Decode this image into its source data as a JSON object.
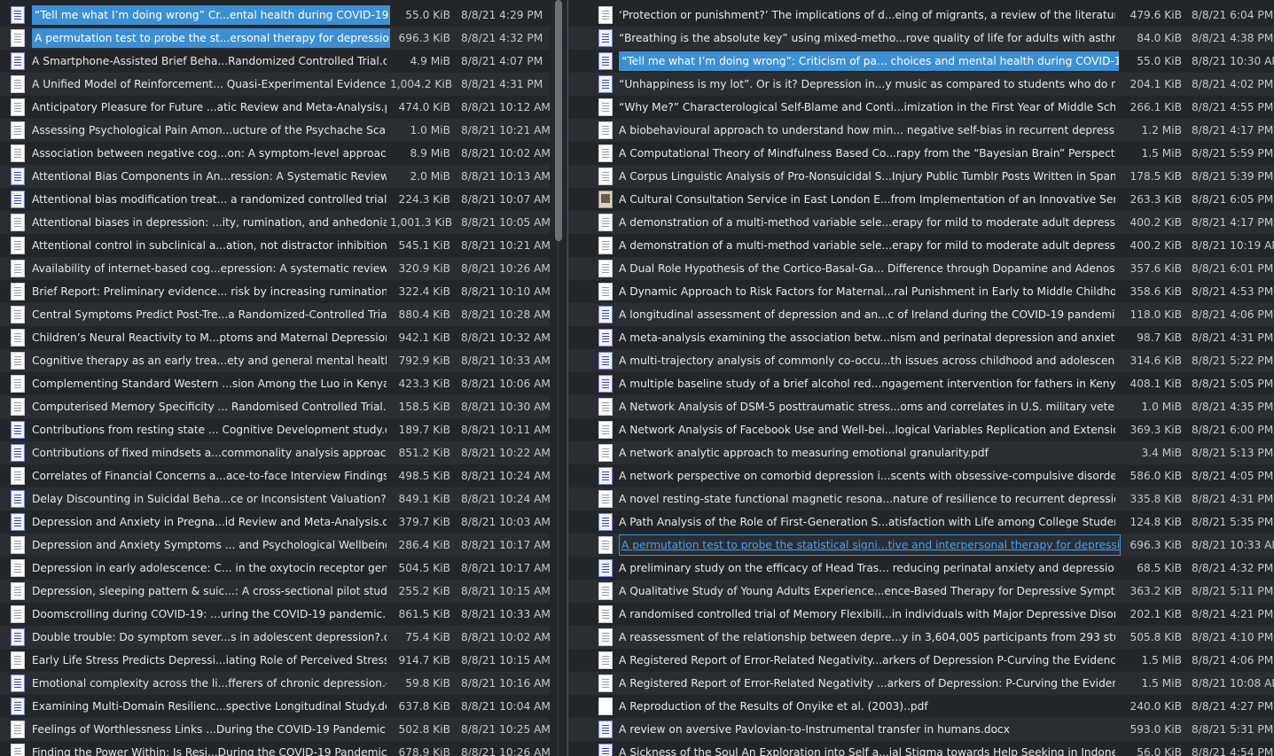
{
  "left": {
    "rows": [
      {
        "icon": "docx",
        "name": "“Tell me what I’m doing wrong” Cr...ental health during COVID-19.docx",
        "size": "55.0 KiB",
        "date": "8/8/21 4:29 PM",
        "state": "selected"
      },
      {
        "icon": "pdf",
        "name": "A permutation test to probe the st...ersonal therapy for depression.pdf",
        "size": "696.3 KiB",
        "date": "8/8/21 4:32 PM",
        "state": "selected"
      },
      {
        "icon": "docx",
        "name": "A Smartphone-Assisted Brief Beha...Randomized Controlled Trial.docx",
        "size": "4.9 MiB",
        "date": "8/8/21 4:07 PM"
      },
      {
        "icon": "pdf",
        "name": "A Unified Model of Reinforcement... Quasi-Experimental Evidence.pdf",
        "size": "1,004.2 KiB",
        "date": "8/8/21 4:31 PM"
      },
      {
        "icon": "pdf",
        "name": "Anticipatory Pleasure for Future ...atic Review and Meta-Analysis.pdf",
        "size": "474.0 KiB",
        "date": "8/8/21 10:12 AM"
      },
      {
        "icon": "pdf",
        "name": "Assessing Psychological Pain Amon...ucture of the Psychache Scale.pdf",
        "size": "1.0 MiB",
        "date": "8/8/21 10:21 AM"
      },
      {
        "icon": "pdf",
        "name": "Association between negative cog...on: A symptom-level approach.pdf",
        "size": "8.9 MiB",
        "date": "8/8/21 10:02 AM"
      },
      {
        "icon": "docx",
        "name": "Attentional Bias Components in An...ression: A Systematic Review.docx",
        "size": "2.0 MiB",
        "date": "8/8/21 10:13 AM"
      },
      {
        "icon": "docx",
        "name": "Attentional bias modification treat... a randomized controlled trial.docx",
        "size": "224.3 KiB",
        "date": "8/8/21 10:07 AM"
      },
      {
        "icon": "pdf",
        "name": "Attentional biases in depression: ...ity, rumination, and anhedonia.pdf",
        "size": "1,001.3 KiB",
        "date": "8/8/21 10:05 AM"
      },
      {
        "icon": "pdf",
        "name": "Attentional control in subclinical a...ation, not distractor inhibition.pdf",
        "size": "545.1 KiB",
        "date": "8/8/21 10:21 AM"
      },
      {
        "icon": "pdf",
        "name": "Availability of internet-based cog...epression: A systematic review.pdf",
        "size": "320.9 KiB",
        "date": "8/8/21 10:26 AM"
      },
      {
        "icon": "pdf",
        "name": "Brief Report: Preliminary evidence... risk by increasing rumination.pdf",
        "size": "322.4 KiB",
        "date": "8/8/21 10:10 AM"
      },
      {
        "icon": "pdf",
        "name": "Central Symptoms Predict Post-Tre...a Randomized-Controlled Trial.pdf",
        "size": "880.4 KiB",
        "date": "8/8/21 10:28 AM"
      },
      {
        "icon": "pdf",
        "name": "Children’s Neural Reactivity to M...ptoms and Maternal Depression.pdf",
        "size": "942.1 KiB",
        "date": "8/8/21 10:32 AM"
      },
      {
        "icon": "pdf",
        "name": "Cognitive therapy as an early trea...ety and general mental health..pdf",
        "size": "792.9 KiB",
        "date": "8/8/21 10:33 AM"
      },
      {
        "icon": "pdf",
        "name": "Complementing Standard Western ...sion Among the Luo in Kenya.pdf",
        "size": "423.3 KiB",
        "date": "8/8/21 10:06 AM"
      },
      {
        "icon": "pdf",
        "name": "Computerised Memory Specificity ... Randomised Controlled Trial.pdf",
        "size": "158.5 KiB",
        "date": "8/8/21 10:30 AM"
      },
      {
        "icon": "docx",
        "name": "Contributions from resting state ... Cognitive Development study.docx",
        "size": "189.7 KiB",
        "date": "8/8/21 10:11 AM"
      },
      {
        "icon": "docx",
        "name": "Contributions of fixed mindsets a...commonality analysis approach.pdf",
        "size": "851.2 KiB",
        "date": "8/8/21 10:22 AM"
      },
      {
        "icon": "pdf",
        "name": "Correlates of Financial Concerns a...ace-to-face Interview Findings.pdf",
        "size": "498.5 KiB",
        "date": "8/8/21 10:24 AM"
      },
      {
        "icon": "docx",
        "name": "Delay Discounting in Suicidal Beha...ce or Inconsistent Valuation?.docx",
        "size": "849.1 KiB",
        "date": "8/8/21 10:24 AM"
      },
      {
        "icon": "docx",
        "name": "Depression and Anxiety in Pregna...id Review and Meta-Analysis.docx",
        "size": "379.7 KiB",
        "date": "8/8/21 10:03 AM"
      },
      {
        "icon": "pdf",
        "name": "Depression and Anxiety Symptoms ... and Psychological Wellbeing.pdf",
        "size": "286.4 KiB",
        "date": "8/8/21 10:17 AM"
      },
      {
        "icon": "pdf",
        "name": "Depression in early adolescence: C... in the oxytocin receptor gene.pdf",
        "size": "504.5 KiB",
        "date": "8/8/21 10:17 AM"
      },
      {
        "icon": "pdf",
        "name": "Depression, sleeping pattern & suic...: A cross-sectional pilot study.pdf",
        "size": "255.2 KiB",
        "date": "8/8/21 10:15 AM"
      },
      {
        "icon": "pdf",
        "name": "Doomscrolling during COVID-19: ...uring the COVID-19 pandemic.pdf",
        "size": "861.5 KiB",
        "date": "8/8/21 10:33 AM"
      },
      {
        "icon": "docx",
        "name": "Double trouble: Do symptom sever...s in adolescent depression?.docx",
        "size": "75.4 KiB",
        "date": "8/8/21 10:02 AM"
      },
      {
        "icon": "pdf",
        "name": "Early Life Stress Predicts Depressi...iating Role of Perceived Stress.pdf",
        "size": "914.7 KiB",
        "date": "8/8/21 10:15 AM"
      },
      {
        "icon": "docx",
        "name": "Emotional complexity across the li...fferers of chronic depression.docx",
        "size": "59.8 KiB",
        "date": "8/8/21 10:16 AM"
      },
      {
        "icon": "docx",
        "name": "Examining Multi-Domain Resilienc...spective Longitudinal Study.docx",
        "size": "637.8 KiB",
        "date": "8/8/21 10:04 AM"
      },
      {
        "icon": "pdf",
        "name": "Feelings of Worthlessness Links ...During the COVID-19 Pandemic.pdf",
        "size": "502.8 KiB",
        "date": "8/8/21 10:25 AM"
      },
      {
        "icon": "pdf",
        "name": "Finding the Power Within: Is Resi...During the COVID-19 Pandemic?.pdf",
        "size": "678.9 KiB",
        "date": "8/8/21 10:26 AM"
      }
    ]
  },
  "right": {
    "rows": [
      {
        "icon": "pdf",
        "name": "‘Protection or punishment?’ The implications of d...eing of migrants, a review of the literature..pdf",
        "size": "479.6 KiB",
        "date": "8/8/21 6:04 PM"
      },
      {
        "icon": "docx",
        "name": "“Breathing is the absolute key” using mixed-metho...rove quality of life for adults with asthma..docx",
        "size": "84.0 KiB",
        "date": "8/8/21 4:38 PM"
      },
      {
        "icon": "docx",
        "name": "“Tell me what I’m doing wrong”: Criticism of pa... choices and mental health during COVID-19.docx",
        "size": "55.0 KiB",
        "date": "8/8/21 10:30 AM",
        "state": "selected"
      },
      {
        "icon": "docx",
        "name": "“Unhappiness is my lot”. Or is it? Depression in...y music as compared to students who do not..docx",
        "size": "204.1 KiB",
        "date": "8/8/21 4:02 PM"
      },
      {
        "icon": "pdf",
        "name": "“Why Me?” Characterological Self-Blame and Conti...imization in the First Year of Middle School.pdf",
        "size": "266.1 KiB",
        "date": "8/8/21 4:55 PM"
      },
      {
        "icon": "pdf",
        "name": "A biobehavioural approach to understand how min... negative self-bias in recurrent depression.pdf",
        "size": "1.2 MiB",
        "date": "8/8/21 4:17 PM"
      },
      {
        "icon": "pdf",
        "name": "A Computational Theory of Mindfulness Based Co...rapy from the “Bayesian Brain” Perspective.pdf",
        "size": "1.5 MiB",
        "date": "8/8/21 5:59 PM"
      },
      {
        "icon": "pdf",
        "name": "A Corpus Linguistic Analysis of Pro-Nonsuicidal S...Injury Public Tumblr Posts Written in Spanish.pdf",
        "size": "178.5 KiB",
        "date": "8/8/21 5:39 PM"
      },
      {
        "icon": "img",
        "name": "A Cultural Consultation Service in East London E...from Implementation of an Innovative Service.pdf",
        "size": "263.3 KiB",
        "date": "8/8/21 6:05 PM"
      },
      {
        "icon": "pdf",
        "name": "A demonstration of a multi-method variable sele...erapy for mild to moderate adult depression.pdf",
        "size": "400.2 KiB",
        "date": "8/8/21 4:17 PM"
      },
      {
        "icon": "pdf",
        "name": "A demonstration of a multi-method variable sele...erapy for mild to moderate adult depression.pdf",
        "size": "400.2 KiB",
        "date": "8/8/21 10:19 AM"
      },
      {
        "icon": "pdf",
        "name": "A Dual Role Hypothesis of the Cortico-Basal-Ga... Difference through Dopamine and Adenosine.pdf",
        "size": "357.6 KiB",
        "date": "8/8/21 6:01 PM"
      },
      {
        "icon": "pdf",
        "name": "A Dynamic Approach to Risk Factors for Maternal...ral Punishment in Early to Middle Childhood.pdf",
        "size": "358.6 KiB",
        "date": "8/8/21 4:53 PM"
      },
      {
        "icon": "docx",
        "name": "A longitudinal assessment of depression and an...c of Ireland during the COVID-19 pandemic.docx",
        "size": "118.0 KiB",
        "date": "8/8/21 4:06 PM"
      },
      {
        "icon": "docx",
        "name": "A meta-analysis examining the association betw...nism and perinatal depression and anxiety.docx",
        "size": "98.7 KiB",
        "date": "8/8/21 4:31 PM"
      },
      {
        "icon": "docx",
        "name": "A multi-trajectory analysis of commonly co-occu...th issues across childhood and adolescence.docx",
        "size": "314.6 KiB",
        "date": "8/8/21 5:22 PM"
      },
      {
        "icon": "docx",
        "name": "A multiple baseline study of a brief alcohol red...ngagement intervention for fathers in Kenya.docx",
        "size": "408.1 KiB",
        "date": "8/8/21 5:05 PM"
      },
      {
        "icon": "pdf",
        "name": "A Network Analysis of DSM-5 posttraumatic stress...oms and correlates in U.S. military veterans.pdf",
        "size": "1.0 MiB",
        "date": "8/8/21 4:35 PM"
      },
      {
        "icon": "pdf",
        "name": "A Network Analysis of Facebook Use and Well-bei...logical Variables Replication and Extension.pdf",
        "size": "369.3 KiB",
        "date": "8/8/21 6:00 PM"
      },
      {
        "icon": "pdf",
        "name": "A network analytic approach to measuring emotional granularity.pdf",
        "size": "3.4 MiB",
        "date": "8/8/21 5:13 PM"
      },
      {
        "icon": "docx",
        "name": "A network perspective on comorbid depression i...scents with obsessive-compulsive disorder.docx",
        "size": "586.0 KiB",
        "date": "8/8/21 4:05 PM"
      },
      {
        "icon": "pdf",
        "name": "A novel resting-state functional magnetic resona...nature of resilience to recurrent depression.pdf",
        "size": "335.8 KiB",
        "date": "8/8/21 4:31 PM"
      },
      {
        "icon": "docx",
        "name": "A Path Analysis of the Role of First-Generation S...atisfaction with Life among College Students.docx",
        "size": "124.8 KiB",
        "date": "8/8/21 5:35 PM"
      },
      {
        "icon": "pdf",
        "name": "A permutation test to probe the statistical signi...tive and interpersonal therapy for depression.pdf",
        "size": "696.3 KiB",
        "date": "8/8/21 10:33 AM",
        "state": "hover"
      },
      {
        "icon": "docx",
        "name": "A preliminary study on the efficacy of Head Tras... reducing perinatal anxiety and depression..docx",
        "size": "68.5 KiB",
        "date": "8/8/21 4:32 PM"
      },
      {
        "icon": "pdf",
        "name": "A Qualitative Study of Young Adults Experience...ence-Based Therapy for Depressive Symptoms.pdf",
        "size": "363.2 KiB",
        "date": "8/8/21 5:11 PM"
      },
      {
        "icon": "pdf",
        "name": "A randomised controlled trial of Memory Flexibili...in individuals with Major Depressive Disorder.pdf",
        "size": "202.1 KiB",
        "date": "8/8/21 4:21 PM"
      },
      {
        "icon": "pdf",
        "name": "A reassessment of the relationship between depre...y in 3,604,005 participants from 293 studies.pdf",
        "size": "505.8 KiB",
        "date": "8/8/21 4:10 PM"
      },
      {
        "icon": "pdf",
        "name": "A Registered Report of Error-Related Negativity...arkers of Depression P-Curving the Evidence.pdf",
        "size": "1.5 MiB",
        "date": "8/8/21 4:06 PM"
      },
      {
        "icon": "pdf",
        "name": "A Registered Report of Error-Related Negativity ...arkers of Depression: P-Curving the Evidence.pdf",
        "size": "1.5 MiB",
        "date": "8/8/21 10:08 AM"
      },
      {
        "icon": "blank",
        "name": "A Reproduction of the Results of Onyike et al. (2003)..pdf",
        "size": "240.0 KiB",
        "date": "8/8/21 4:27 PM"
      },
      {
        "icon": "docx",
        "name": "A review on aversive Pavlovian-to-Instrumental transfer in humans.docx",
        "size": "593.0 KiB",
        "date": "8/8/21 5:31 PM"
      },
      {
        "icon": "docx",
        "name": "A Sickness of the Soul An Exploration into Self a...ial Stigma towards Help Seeking in Indonesia.docx",
        "size": "56.0 KiB",
        "date": "8/8/21 4:54 PM"
      }
    ]
  }
}
